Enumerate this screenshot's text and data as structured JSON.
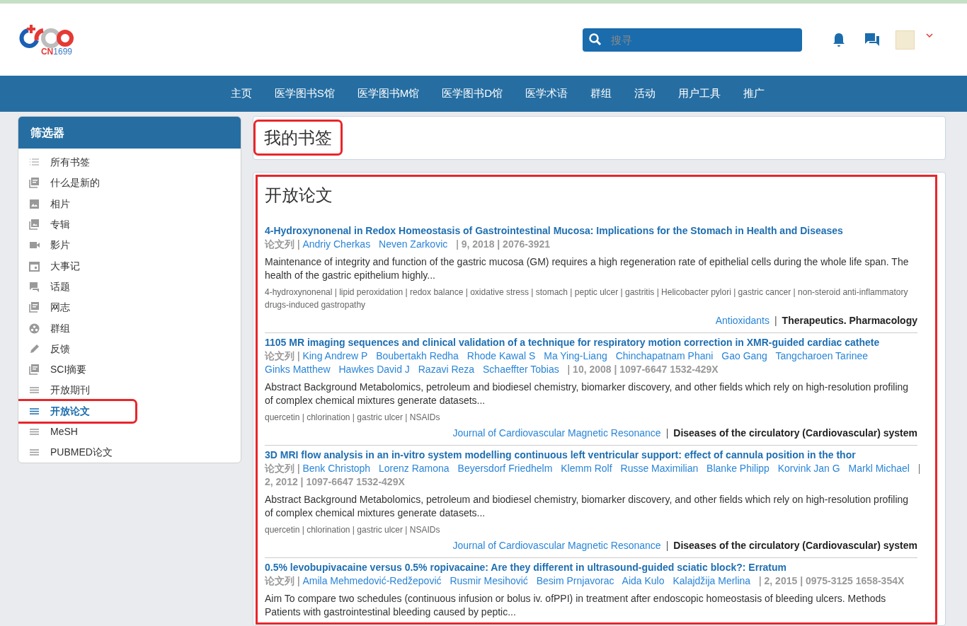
{
  "logo": {
    "text_red": "CN",
    "text_blue": "1699"
  },
  "search": {
    "placeholder": "搜寻"
  },
  "nav": [
    "主页",
    "医学图书S馆",
    "医学图书M馆",
    "医学图书D馆",
    "医学术语",
    "群组",
    "活动",
    "用户工具",
    "推广"
  ],
  "sidebar": {
    "title": "筛选器",
    "items": [
      {
        "label": "所有书签",
        "kind": "list",
        "selected": false,
        "annotated": false
      },
      {
        "label": "什么是新的",
        "kind": "doc",
        "selected": false,
        "annotated": false
      },
      {
        "label": "相片",
        "kind": "image",
        "selected": false,
        "annotated": false
      },
      {
        "label": "专辑",
        "kind": "album",
        "selected": false,
        "annotated": false
      },
      {
        "label": "影片",
        "kind": "video",
        "selected": false,
        "annotated": false
      },
      {
        "label": "大事记",
        "kind": "calendar",
        "selected": false,
        "annotated": false
      },
      {
        "label": "话题",
        "kind": "chat",
        "selected": false,
        "annotated": false
      },
      {
        "label": "网志",
        "kind": "doc",
        "selected": false,
        "annotated": false
      },
      {
        "label": "群组",
        "kind": "group",
        "selected": false,
        "annotated": false
      },
      {
        "label": "反馈",
        "kind": "pencil",
        "selected": false,
        "annotated": false
      },
      {
        "label": "SCI摘要",
        "kind": "doc",
        "selected": false,
        "annotated": false
      },
      {
        "label": "开放期刊",
        "kind": "lines",
        "selected": false,
        "annotated": false
      },
      {
        "label": "开放论文",
        "kind": "lines",
        "selected": true,
        "annotated": true
      },
      {
        "label": "MeSH",
        "kind": "lines",
        "selected": false,
        "annotated": false
      },
      {
        "label": "PUBMED论文",
        "kind": "lines",
        "selected": false,
        "annotated": false
      }
    ]
  },
  "page_title": {
    "text": "我的书签",
    "annotated": true
  },
  "panel": {
    "title": "开放论文",
    "annotated": true,
    "separator": "|",
    "articles": [
      {
        "title": "4-Hydroxynonenal in Redox Homeostasis of Gastrointestinal Mucosa: Implications for the Stomach in Health and Diseases",
        "series": "论文列",
        "authors": [
          "Andriy Cherkas",
          "Neven Zarkovic"
        ],
        "info": "9, 2018 | 2076-3921",
        "abstract": "Maintenance of integrity and function of the gastric mucosa (GM) requires a high regeneration rate of epithelial cells during the whole life span. The health of the gastric epithelium highly...",
        "keywords": "4-hydroxynonenal | lipid peroxidation | redox balance | oxidative stress | stomach | peptic ulcer | gastritis | Helicobacter pylori | gastric cancer | non-steroid anti-inflammatory drugs-induced gastropathy",
        "journal": "Antioxidants",
        "category": "Therapeutics. Pharmacology"
      },
      {
        "title": "1105 MR imaging sequences and clinical validation of a technique for respiratory motion correction in XMR-guided cardiac cathete",
        "series": "论文列",
        "authors": [
          "King Andrew P",
          "Boubertakh Redha",
          "Rhode Kawal S",
          "Ma Ying-Liang",
          "Chinchapatnam Phani",
          "Gao Gang",
          "Tangcharoen Tarinee",
          "Ginks Matthew",
          "Hawkes David J",
          "Razavi Reza",
          "Schaeffter Tobias"
        ],
        "info": "10, 2008 | 1097-6647 1532-429X",
        "abstract": "Abstract Background Metabolomics, petroleum and biodiesel chemistry, biomarker discovery, and other fields which rely on high-resolution profiling of complex chemical mixtures generate datasets...",
        "keywords": "quercetin | chlorination | gastric ulcer | NSAIDs",
        "journal": "Journal of Cardiovascular Magnetic Resonance",
        "category": "Diseases of the circulatory (Cardiovascular) system"
      },
      {
        "title": "3D MRI flow analysis in an in-vitro system modelling continuous left ventricular support: effect of cannula position in the thor",
        "series": "论文列",
        "authors": [
          "Benk Christoph",
          "Lorenz Ramona",
          "Beyersdorf Friedhelm",
          "Klemm Rolf",
          "Russe Maximilian",
          "Blanke Philipp",
          "Korvink Jan G",
          "Markl Michael"
        ],
        "info": "2, 2012 | 1097-6647 1532-429X",
        "abstract": "Abstract Background Metabolomics, petroleum and biodiesel chemistry, biomarker discovery, and other fields which rely on high-resolution profiling of complex chemical mixtures generate datasets...",
        "keywords": "quercetin | chlorination | gastric ulcer | NSAIDs",
        "journal": "Journal of Cardiovascular Magnetic Resonance",
        "category": "Diseases of the circulatory (Cardiovascular) system"
      },
      {
        "title": "0.5% levobupivacaine versus 0.5% ropivacaine: Are they different in ultrasound-guided sciatic block?: Erratum",
        "series": "论文列",
        "authors": [
          "Amila Mehmedović-Redžepović",
          "Rusmir Mesihović",
          "Besim Prnjavorac",
          "Aida Kulo",
          "Kalajdžija Merlina"
        ],
        "info": "2, 2015 | 0975-3125 1658-354X",
        "abstract": "Aim To compare two schedules (continuous infusion or bolus iv. ofPPI) in treatment after endoscopic homeostasis of bleeding ulcers. Methods Patients with gastrointestinal bleeding caused by peptic..."
      }
    ]
  }
}
